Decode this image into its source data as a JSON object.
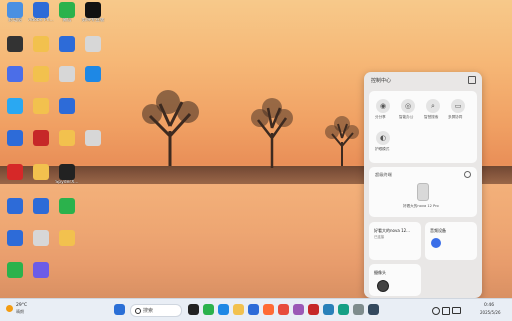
{
  "desktop": {
    "icons": [
      {
        "label": "此电脑",
        "color": "#4a90e2"
      },
      {
        "label": "Adobe Ph...",
        "color": "#2d6bd8"
      },
      {
        "label": "微信",
        "color": "#2bb24c"
      },
      {
        "label": "剪映专业版",
        "color": "#111111"
      },
      {
        "label": "",
        "color": "#333333"
      },
      {
        "label": "",
        "color": "#f2c14e"
      },
      {
        "label": "",
        "color": "#2d6bd8"
      },
      {
        "label": "",
        "color": "#d7d7d7"
      },
      {
        "label": "",
        "color": "#4b6ee8"
      },
      {
        "label": "",
        "color": "#f2c14e"
      },
      {
        "label": "",
        "color": "#d7d7d7"
      },
      {
        "label": "",
        "color": "#1e88e5"
      },
      {
        "label": "",
        "color": "#2aa8f2"
      },
      {
        "label": "",
        "color": "#f2c14e"
      },
      {
        "label": "",
        "color": "#2d6bd8"
      },
      {
        "label": "",
        "color": "#2d6bd8"
      },
      {
        "label": "",
        "color": "#c62828"
      },
      {
        "label": "",
        "color": "#f2c14e"
      },
      {
        "label": "",
        "color": "#d7d7d7"
      },
      {
        "label": "",
        "color": "#d62828"
      },
      {
        "label": "",
        "color": "#f2c14e"
      },
      {
        "label": "SpyderX...",
        "color": "#222222"
      },
      {
        "label": "",
        "color": "#2d6bd8"
      },
      {
        "label": "",
        "color": "#2d6bd8"
      },
      {
        "label": "",
        "color": "#2bb24c"
      },
      {
        "label": "",
        "color": "#2d6bd8"
      },
      {
        "label": "",
        "color": "#d7d7d7"
      },
      {
        "label": "",
        "color": "#f2c14e"
      },
      {
        "label": "",
        "color": "#2bb24c"
      },
      {
        "label": "",
        "color": "#6c5ce7"
      }
    ]
  },
  "control_center": {
    "title": "控制中心",
    "quick_toggles": [
      {
        "label": "分分享",
        "icon": "share-icon"
      },
      {
        "label": "智能办公",
        "icon": "target-icon"
      },
      {
        "label": "智慧搜索",
        "icon": "search-icon"
      },
      {
        "label": "多屏协同",
        "icon": "screens-icon"
      },
      {
        "label": "护眼模式",
        "icon": "eye-icon"
      }
    ],
    "nearby": {
      "title": "超级终端",
      "device_name": "好看大的nova 12 Pro"
    },
    "device_card": {
      "title": "好看大的nova 12...",
      "subtitle": "已连接"
    },
    "audio_card": {
      "title": "音频设备"
    },
    "camera_card": {
      "title": "摄像头"
    }
  },
  "taskbar": {
    "weather": "29°C",
    "weather_sub": "晴朗",
    "search_placeholder": "搜索",
    "time": "0:46",
    "date": "2025/5/26"
  }
}
